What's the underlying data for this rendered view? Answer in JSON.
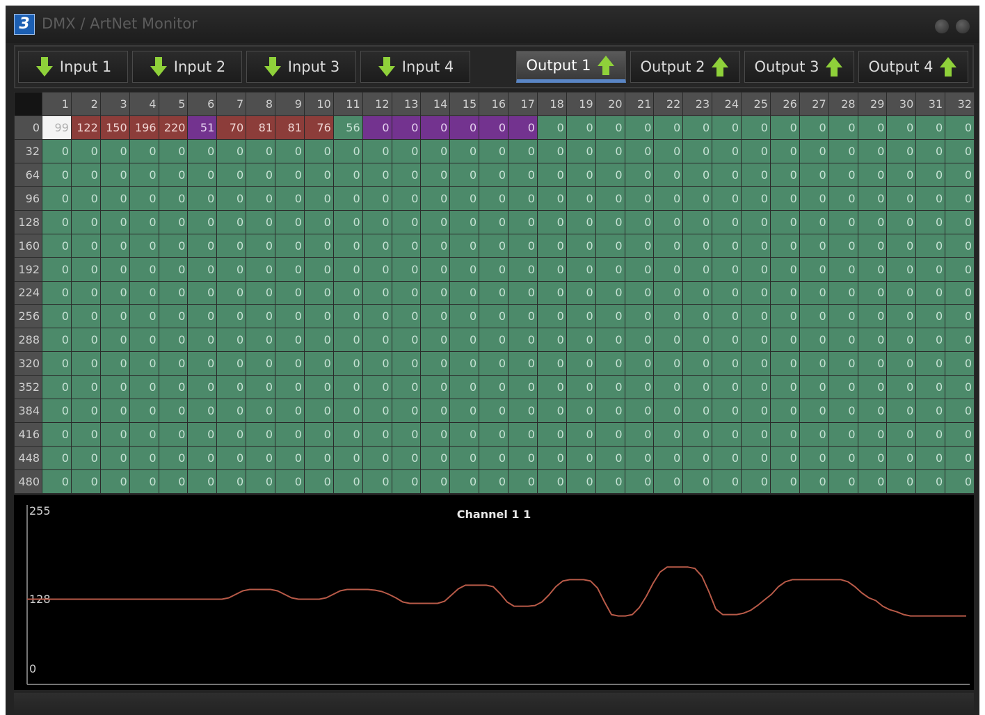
{
  "window": {
    "title": "DMX / ArtNet Monitor"
  },
  "tabs": [
    {
      "label": "Input 1",
      "direction": "input",
      "active": false
    },
    {
      "label": "Input 2",
      "direction": "input",
      "active": false
    },
    {
      "label": "Input 3",
      "direction": "input",
      "active": false
    },
    {
      "label": "Input 4",
      "direction": "input",
      "active": false
    },
    {
      "label": "Output 1",
      "direction": "output",
      "active": true
    },
    {
      "label": "Output 2",
      "direction": "output",
      "active": false
    },
    {
      "label": "Output 3",
      "direction": "output",
      "active": false
    },
    {
      "label": "Output 4",
      "direction": "output",
      "active": false
    }
  ],
  "grid": {
    "column_headers": [
      "1",
      "2",
      "3",
      "4",
      "5",
      "6",
      "7",
      "8",
      "9",
      "10",
      "11",
      "12",
      "13",
      "14",
      "15",
      "16",
      "17",
      "18",
      "19",
      "20",
      "21",
      "22",
      "23",
      "24",
      "25",
      "26",
      "27",
      "28",
      "29",
      "30",
      "31",
      "32"
    ],
    "row_headers": [
      "0",
      "32",
      "64",
      "96",
      "128",
      "160",
      "192",
      "224",
      "256",
      "288",
      "320",
      "352",
      "384",
      "416",
      "448",
      "480"
    ],
    "first_row_values": [
      "99",
      "122",
      "150",
      "196",
      "220",
      "51",
      "70",
      "81",
      "81",
      "76",
      "56",
      "0",
      "0",
      "0",
      "0",
      "0",
      "0",
      "0",
      "0",
      "0",
      "0",
      "0",
      "0",
      "0",
      "0",
      "0",
      "0",
      "0",
      "0",
      "0",
      "0",
      "0"
    ],
    "first_row_colors": [
      "white",
      "red",
      "red",
      "red",
      "red",
      "purple",
      "red",
      "red",
      "red",
      "red",
      "green",
      "purple",
      "purple",
      "purple",
      "purple",
      "purple",
      "purple",
      "green",
      "green",
      "green",
      "green",
      "green",
      "green",
      "green",
      "green",
      "green",
      "green",
      "green",
      "green",
      "green",
      "green",
      "green"
    ],
    "default_value": "0",
    "default_color": "green"
  },
  "colors": {
    "white": "#f4f4f4",
    "red": "#8c3d3a",
    "purple": "#73338f",
    "green": "#4c8a6a",
    "active_tab_underline": "#5a86c6",
    "arrow": "#8fd13a",
    "trace": "#b85a48"
  },
  "chart_data": {
    "type": "line",
    "title": "Channel 1  1",
    "ylim": [
      0,
      255
    ],
    "yticks": [
      "255",
      "128",
      "0"
    ],
    "series": [
      {
        "x": [
          0,
          170,
          180,
          190,
          200,
          210,
          220,
          230,
          240,
          250,
          260,
          270,
          280,
          290,
          300,
          310,
          320,
          330,
          340,
          350,
          360,
          370,
          380,
          390,
          400,
          410,
          420,
          430,
          440,
          450,
          460,
          470,
          480,
          490,
          500,
          510,
          520,
          530,
          540,
          550,
          560,
          570,
          580,
          590,
          600,
          610,
          620,
          630,
          640,
          650,
          660,
          670,
          680,
          690,
          700,
          710,
          720,
          730,
          740,
          750,
          760,
          770,
          780,
          790,
          800,
          810,
          820,
          830,
          840,
          850,
          860,
          870,
          880,
          890,
          900,
          910,
          920,
          930,
          940,
          950,
          960,
          970,
          980,
          990,
          1000,
          1010,
          1020,
          1030,
          1040,
          1050,
          1060,
          1070,
          1080,
          1090,
          1100,
          1110,
          1120,
          1130,
          1140,
          1150,
          1160,
          1170,
          1180,
          1190,
          1200,
          1210,
          1220,
          1230,
          1240,
          1250,
          1260,
          1270,
          1280,
          1290,
          1300,
          1310,
          1320,
          1330,
          1340,
          1350
        ],
        "y": [
          122,
          122,
          122,
          122,
          122,
          122,
          122,
          122,
          122,
          122,
          122,
          122,
          122,
          124,
          129,
          134,
          136,
          136,
          136,
          136,
          134,
          129,
          124,
          122,
          122,
          122,
          122,
          124,
          129,
          134,
          136,
          136,
          136,
          136,
          135,
          133,
          129,
          124,
          118,
          116,
          116,
          116,
          116,
          116,
          119,
          128,
          137,
          142,
          142,
          142,
          142,
          140,
          130,
          118,
          112,
          112,
          112,
          113,
          118,
          128,
          140,
          148,
          150,
          150,
          150,
          148,
          138,
          118,
          100,
          98,
          98,
          100,
          110,
          126,
          145,
          161,
          168,
          168,
          168,
          168,
          166,
          155,
          133,
          108,
          100,
          100,
          100,
          102,
          106,
          113,
          121,
          129,
          140,
          147,
          150,
          150,
          150,
          150,
          150,
          150,
          150,
          150,
          147,
          140,
          131,
          124,
          120,
          112,
          107,
          104,
          100,
          98,
          98,
          98,
          98,
          98,
          98,
          98,
          98,
          98
        ]
      }
    ]
  }
}
